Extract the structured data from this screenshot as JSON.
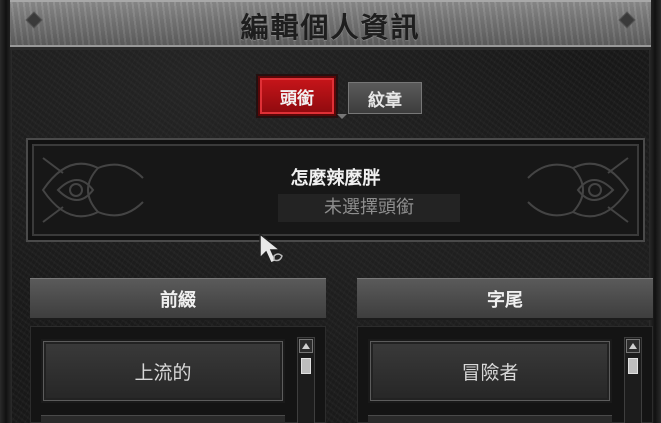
{
  "window": {
    "title": "編輯個人資訊"
  },
  "tabs": [
    {
      "label": "頭銜",
      "active": true
    },
    {
      "label": "紋章",
      "active": false
    }
  ],
  "profile": {
    "character_name": "怎麼辣麼胖",
    "current_title": "未選擇頭銜"
  },
  "prefix_column": {
    "header": "前綴",
    "items": [
      {
        "label": "上流的"
      }
    ]
  },
  "suffix_column": {
    "header": "字尾",
    "items": [
      {
        "label": "冒險者"
      }
    ]
  },
  "colors": {
    "active_tab": "#c8151a",
    "title_bar": "#7a7a7a",
    "background": "#1a1a1a"
  }
}
